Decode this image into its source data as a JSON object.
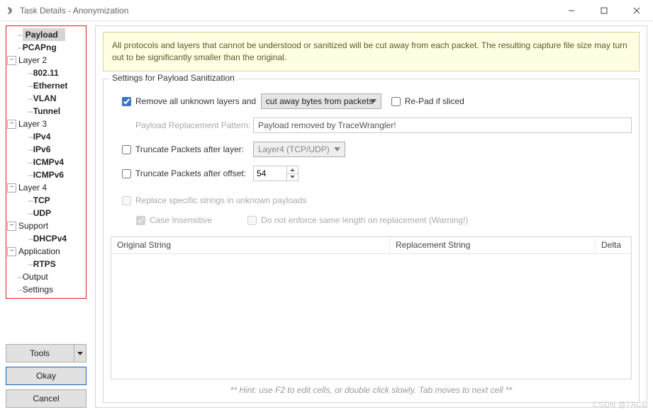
{
  "window": {
    "title": "Task Details - Anonymization",
    "buttons": {
      "min": "—",
      "max": "☐",
      "close": "✕"
    }
  },
  "tree": {
    "items": [
      {
        "kind": "leaf",
        "depth": 1,
        "label": "Payload",
        "selected": true,
        "bold": true
      },
      {
        "kind": "leaf",
        "depth": 1,
        "label": "PCAPng",
        "bold": true
      },
      {
        "kind": "branch",
        "depth": 0,
        "label": "Layer 2",
        "expanded": true
      },
      {
        "kind": "leaf",
        "depth": 2,
        "label": "802.11",
        "bold": true
      },
      {
        "kind": "leaf",
        "depth": 2,
        "label": "Ethernet",
        "bold": true
      },
      {
        "kind": "leaf",
        "depth": 2,
        "label": "VLAN",
        "bold": true
      },
      {
        "kind": "leaf",
        "depth": 2,
        "label": "Tunnel",
        "bold": true
      },
      {
        "kind": "branch",
        "depth": 0,
        "label": "Layer 3",
        "expanded": true
      },
      {
        "kind": "leaf",
        "depth": 2,
        "label": "IPv4",
        "bold": true
      },
      {
        "kind": "leaf",
        "depth": 2,
        "label": "IPv6",
        "bold": true
      },
      {
        "kind": "leaf",
        "depth": 2,
        "label": "ICMPv4",
        "bold": true
      },
      {
        "kind": "leaf",
        "depth": 2,
        "label": "ICMPv6",
        "bold": true
      },
      {
        "kind": "branch",
        "depth": 0,
        "label": "Layer 4",
        "expanded": true
      },
      {
        "kind": "leaf",
        "depth": 2,
        "label": "TCP",
        "bold": true
      },
      {
        "kind": "leaf",
        "depth": 2,
        "label": "UDP",
        "bold": true
      },
      {
        "kind": "branch",
        "depth": 0,
        "label": "Support",
        "expanded": true
      },
      {
        "kind": "leaf",
        "depth": 2,
        "label": "DHCPv4",
        "bold": true
      },
      {
        "kind": "branch",
        "depth": 0,
        "label": "Application",
        "expanded": true
      },
      {
        "kind": "leaf",
        "depth": 2,
        "label": "RTPS",
        "bold": true
      },
      {
        "kind": "leaf",
        "depth": 1,
        "label": "Output"
      },
      {
        "kind": "leaf",
        "depth": 1,
        "label": "Settings"
      }
    ]
  },
  "bottomButtons": {
    "tools": "Tools",
    "okay": "Okay",
    "cancel": "Cancel"
  },
  "info": "All protocols and layers that cannot be understood or sanitized will be cut away from each packet. The resulting capture file size may turn out to be significantly smaller than the original.",
  "group": {
    "legend": "Settings for Payload Sanitization",
    "removeUnknown": {
      "label": "Remove all unknown layers and",
      "checked": true,
      "action": "cut away bytes from packets"
    },
    "repad": {
      "label": "Re-Pad if sliced",
      "checked": false
    },
    "replacement": {
      "label": "Payload Replacement Pattern:",
      "value": "Payload removed by TraceWrangler!"
    },
    "truncateLayer": {
      "label": "Truncate Packets after layer:",
      "checked": false,
      "value": "Layer4 (TCP/UDP)"
    },
    "truncateOffset": {
      "label": "Truncate Packets after offset:",
      "checked": false,
      "value": "54"
    },
    "replaceStrings": {
      "label": "Replace specific strings in unknown payloads",
      "checked": false
    },
    "caseInsensitive": {
      "label": "Case Insensitive",
      "checked": true
    },
    "enforceLen": {
      "label": "Do not enforce same length on replacement (Warning!)",
      "checked": false
    },
    "table": {
      "col1": "Original String",
      "col2": "Replacement String",
      "col3": "Delta"
    },
    "hint": "** Hint: use F2 to edit cells, or double click slowly. Tab moves to next cell **"
  },
  "watermark": "CSDN @7ACE"
}
